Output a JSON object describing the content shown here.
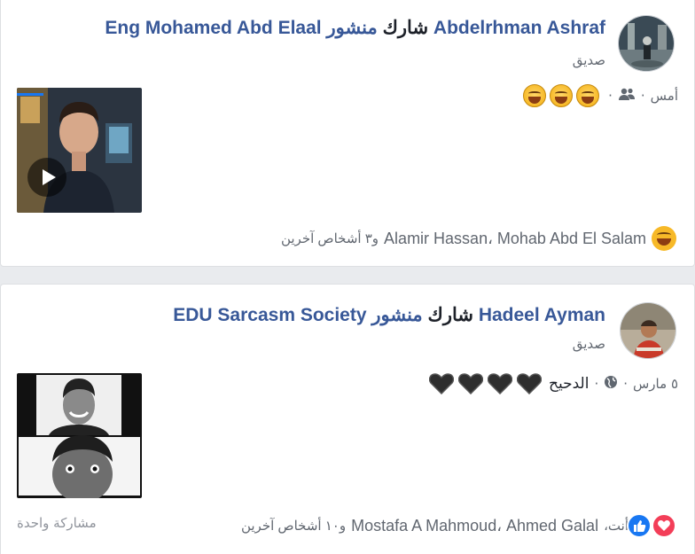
{
  "posts": [
    {
      "author": "Abdelrhman Ashraf",
      "verb": "شارك",
      "object": "منشور",
      "shared_from": "Eng Mohamed Abd Elaal",
      "relation": "صديق",
      "time": "أمس",
      "audience_icon": "friends-icon",
      "caption_emojis": [
        "laughing-tears-emoji",
        "laughing-tears-emoji",
        "laughing-tears-emoji"
      ],
      "media": "video",
      "reactions": [
        "haha"
      ],
      "reactors_text": "Alamir Hassan، Mohab Abd El Salam",
      "others_text": "و٣ أشخاص آخرين",
      "shares_text": ""
    },
    {
      "author": "Hadeel Ayman",
      "verb": "شارك",
      "object": "منشور",
      "shared_from": "EDU Sarcasm Society",
      "relation": "صديق",
      "time": "٥ مارس",
      "audience_icon": "globe-icon",
      "caption_text": "الدحيح",
      "caption_emojis": [
        "black-heart-emoji",
        "black-heart-emoji",
        "black-heart-emoji",
        "black-heart-emoji"
      ],
      "media": "photo",
      "reactions": [
        "love",
        "like"
      ],
      "reactors_you": "أنت،",
      "reactors_text": "Mostafa A Mahmoud، Ahmed Galal",
      "others_text": "و١٠ أشخاص آخرين",
      "shares_text": "مشاركة واحدة"
    }
  ],
  "separator": "·"
}
